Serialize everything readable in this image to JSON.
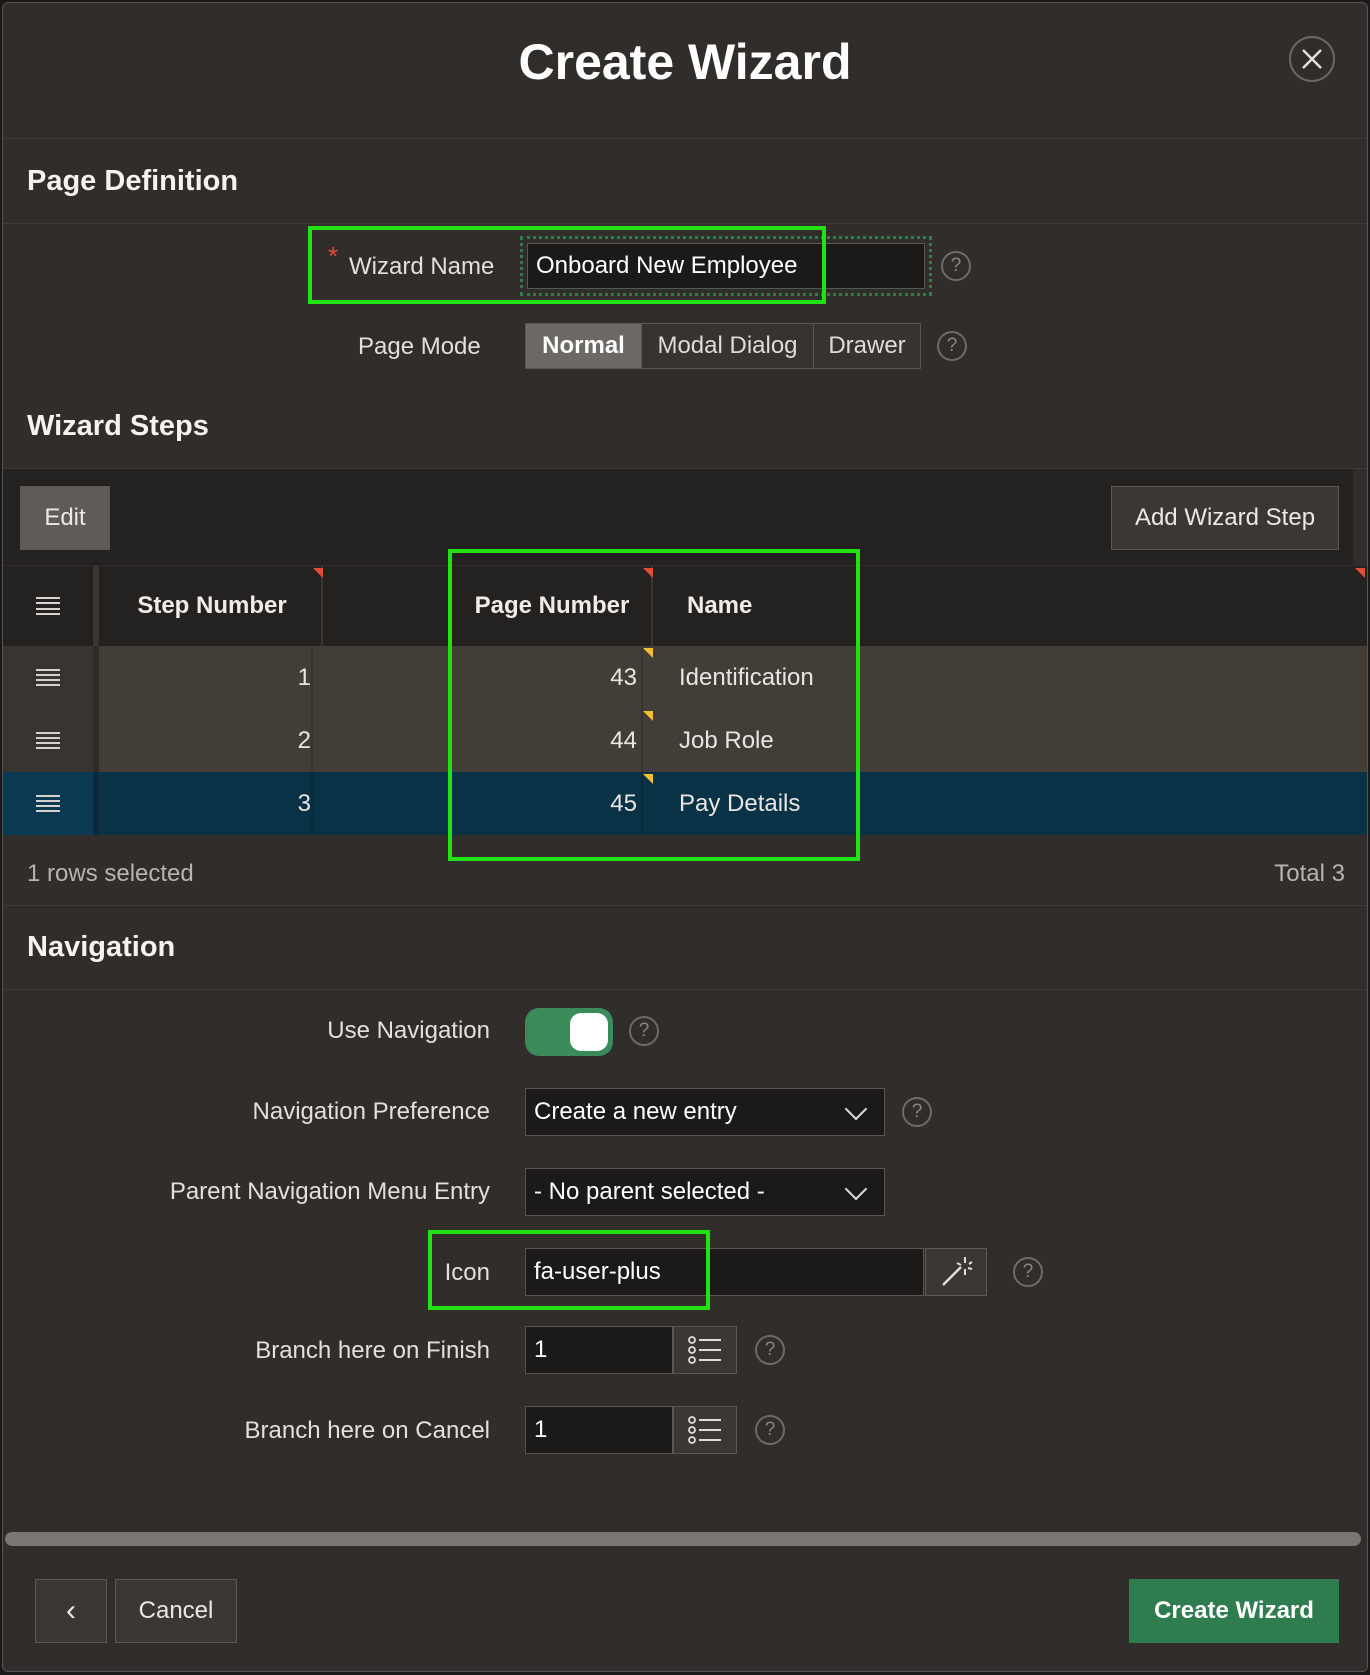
{
  "dialog": {
    "title": "Create Wizard",
    "close_icon": "close-icon"
  },
  "page_definition": {
    "heading": "Page Definition",
    "wizard_name": {
      "label": "Wizard Name",
      "value": "Onboard New Employee",
      "required_marker": "*"
    },
    "page_mode": {
      "label": "Page Mode",
      "options": [
        "Normal",
        "Modal Dialog",
        "Drawer"
      ],
      "selected": "Normal"
    },
    "help_glyph": "?"
  },
  "wizard_steps": {
    "heading": "Wizard Steps",
    "edit_label": "Edit",
    "add_step_label": "Add Wizard Step",
    "columns": {
      "step_number": "Step Number",
      "page_number": "Page Number",
      "name": "Name"
    },
    "rows": [
      {
        "step": "1",
        "page": "43",
        "name": "Identification",
        "selected": false
      },
      {
        "step": "2",
        "page": "44",
        "name": "Job Role",
        "selected": false
      },
      {
        "step": "3",
        "page": "45",
        "name": "Pay Details",
        "selected": true
      }
    ],
    "footer_selected": "1 rows selected",
    "footer_total": "Total 3"
  },
  "navigation": {
    "heading": "Navigation",
    "use_navigation": {
      "label": "Use Navigation",
      "on": true
    },
    "preference": {
      "label": "Navigation Preference",
      "value": "Create a new entry"
    },
    "parent_entry": {
      "label": "Parent Navigation Menu Entry",
      "value": "- No parent selected -"
    },
    "icon": {
      "label": "Icon",
      "value": "fa-user-plus"
    },
    "branch_finish": {
      "label": "Branch here on Finish",
      "value": "1"
    },
    "branch_cancel": {
      "label": "Branch here on Cancel",
      "value": "1"
    }
  },
  "footer": {
    "back_glyph": "‹",
    "cancel_label": "Cancel",
    "create_label": "Create Wizard"
  },
  "colors": {
    "highlight": "#21e314",
    "primary_button": "#2f7d4f",
    "selected_row": "#0a3246",
    "toggle_on": "#3a8a5a"
  }
}
